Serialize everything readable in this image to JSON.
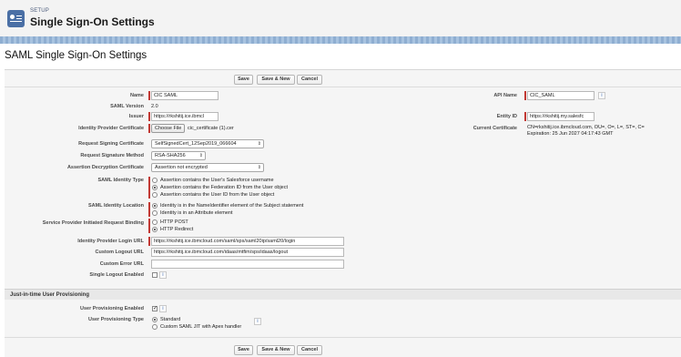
{
  "header": {
    "eyebrow": "SETUP",
    "title": "Single Sign-On Settings"
  },
  "page_title": "SAML Single Sign-On Settings",
  "buttons": {
    "save": "Save",
    "save_new": "Save & New",
    "cancel": "Cancel"
  },
  "fields": {
    "name": {
      "label": "Name",
      "value": "CIC SAML"
    },
    "api_name": {
      "label": "API Name",
      "value": "CIC_SAML"
    },
    "saml_version": {
      "label": "SAML Version",
      "value": "2.0"
    },
    "issuer": {
      "label": "Issuer",
      "value": "https://rkshitij.ice.ibmcl"
    },
    "entity_id": {
      "label": "Entity ID",
      "value": "https://rkshitij.my.salesfc"
    },
    "idp_cert": {
      "label": "Identity Provider Certificate",
      "button": "Choose File",
      "filename": "cic_certificate (1).cer"
    },
    "current_cert": {
      "label": "Current Certificate",
      "line1": "CN=rkshitij.ice.ibmcloud.com, OU=, O=, L=, ST=, C=",
      "line2": "Expiration: 25 Jun 2027 04:17:43 GMT"
    },
    "request_signing_cert": {
      "label": "Request Signing Certificate",
      "value": "SelfSignedCert_12Sep2019_066604"
    },
    "request_sig_method": {
      "label": "Request Signature Method",
      "value": "RSA-SHA256"
    },
    "assertion_decrypt_cert": {
      "label": "Assertion Decryption Certificate",
      "value": "Assertion not encrypted"
    },
    "saml_identity_type": {
      "label": "SAML Identity Type",
      "options": [
        "Assertion contains the User's Salesforce username",
        "Assertion contains the Federation ID from the User object",
        "Assertion contains the User ID from the User object"
      ],
      "selected_index": 1
    },
    "saml_identity_location": {
      "label": "SAML Identity Location",
      "options": [
        "Identity is in the NameIdentifier element of the Subject statement",
        "Identity is in an Attribute element"
      ],
      "selected_index": 0
    },
    "sp_initiated_binding": {
      "label": "Service Provider Initiated Request Binding",
      "options": [
        "HTTP POST",
        "HTTP Redirect"
      ],
      "selected_index": 1
    },
    "idp_login_url": {
      "label": "Identity Provider Login URL",
      "value": "https://rkshitij.ice.ibmcloud.com/saml/sps/saml20ip/saml20/login"
    },
    "custom_logout_url": {
      "label": "Custom Logout URL",
      "value": "https://rkshitij.ice.ibmcloud.com/idaas/mtfim/sps/idaas/logout"
    },
    "custom_error_url": {
      "label": "Custom Error URL",
      "value": ""
    },
    "single_logout": {
      "label": "Single Logout Enabled",
      "checked": false
    }
  },
  "jit_section": {
    "title": "Just-in-time User Provisioning",
    "user_provisioning_enabled": {
      "label": "User Provisioning Enabled",
      "checked": true
    },
    "user_provisioning_type": {
      "label": "User Provisioning Type",
      "options": [
        "Standard",
        "Custom SAML JIT with Apex handler"
      ],
      "selected_index": 0
    }
  },
  "icons": {
    "setup": "settings-card-icon",
    "info": "info-icon"
  },
  "colors": {
    "required_bar": "#c23934",
    "header_bg": "#f3f3f3",
    "stripe": "#8faed1",
    "setup_icon": "#4a6fa5"
  }
}
